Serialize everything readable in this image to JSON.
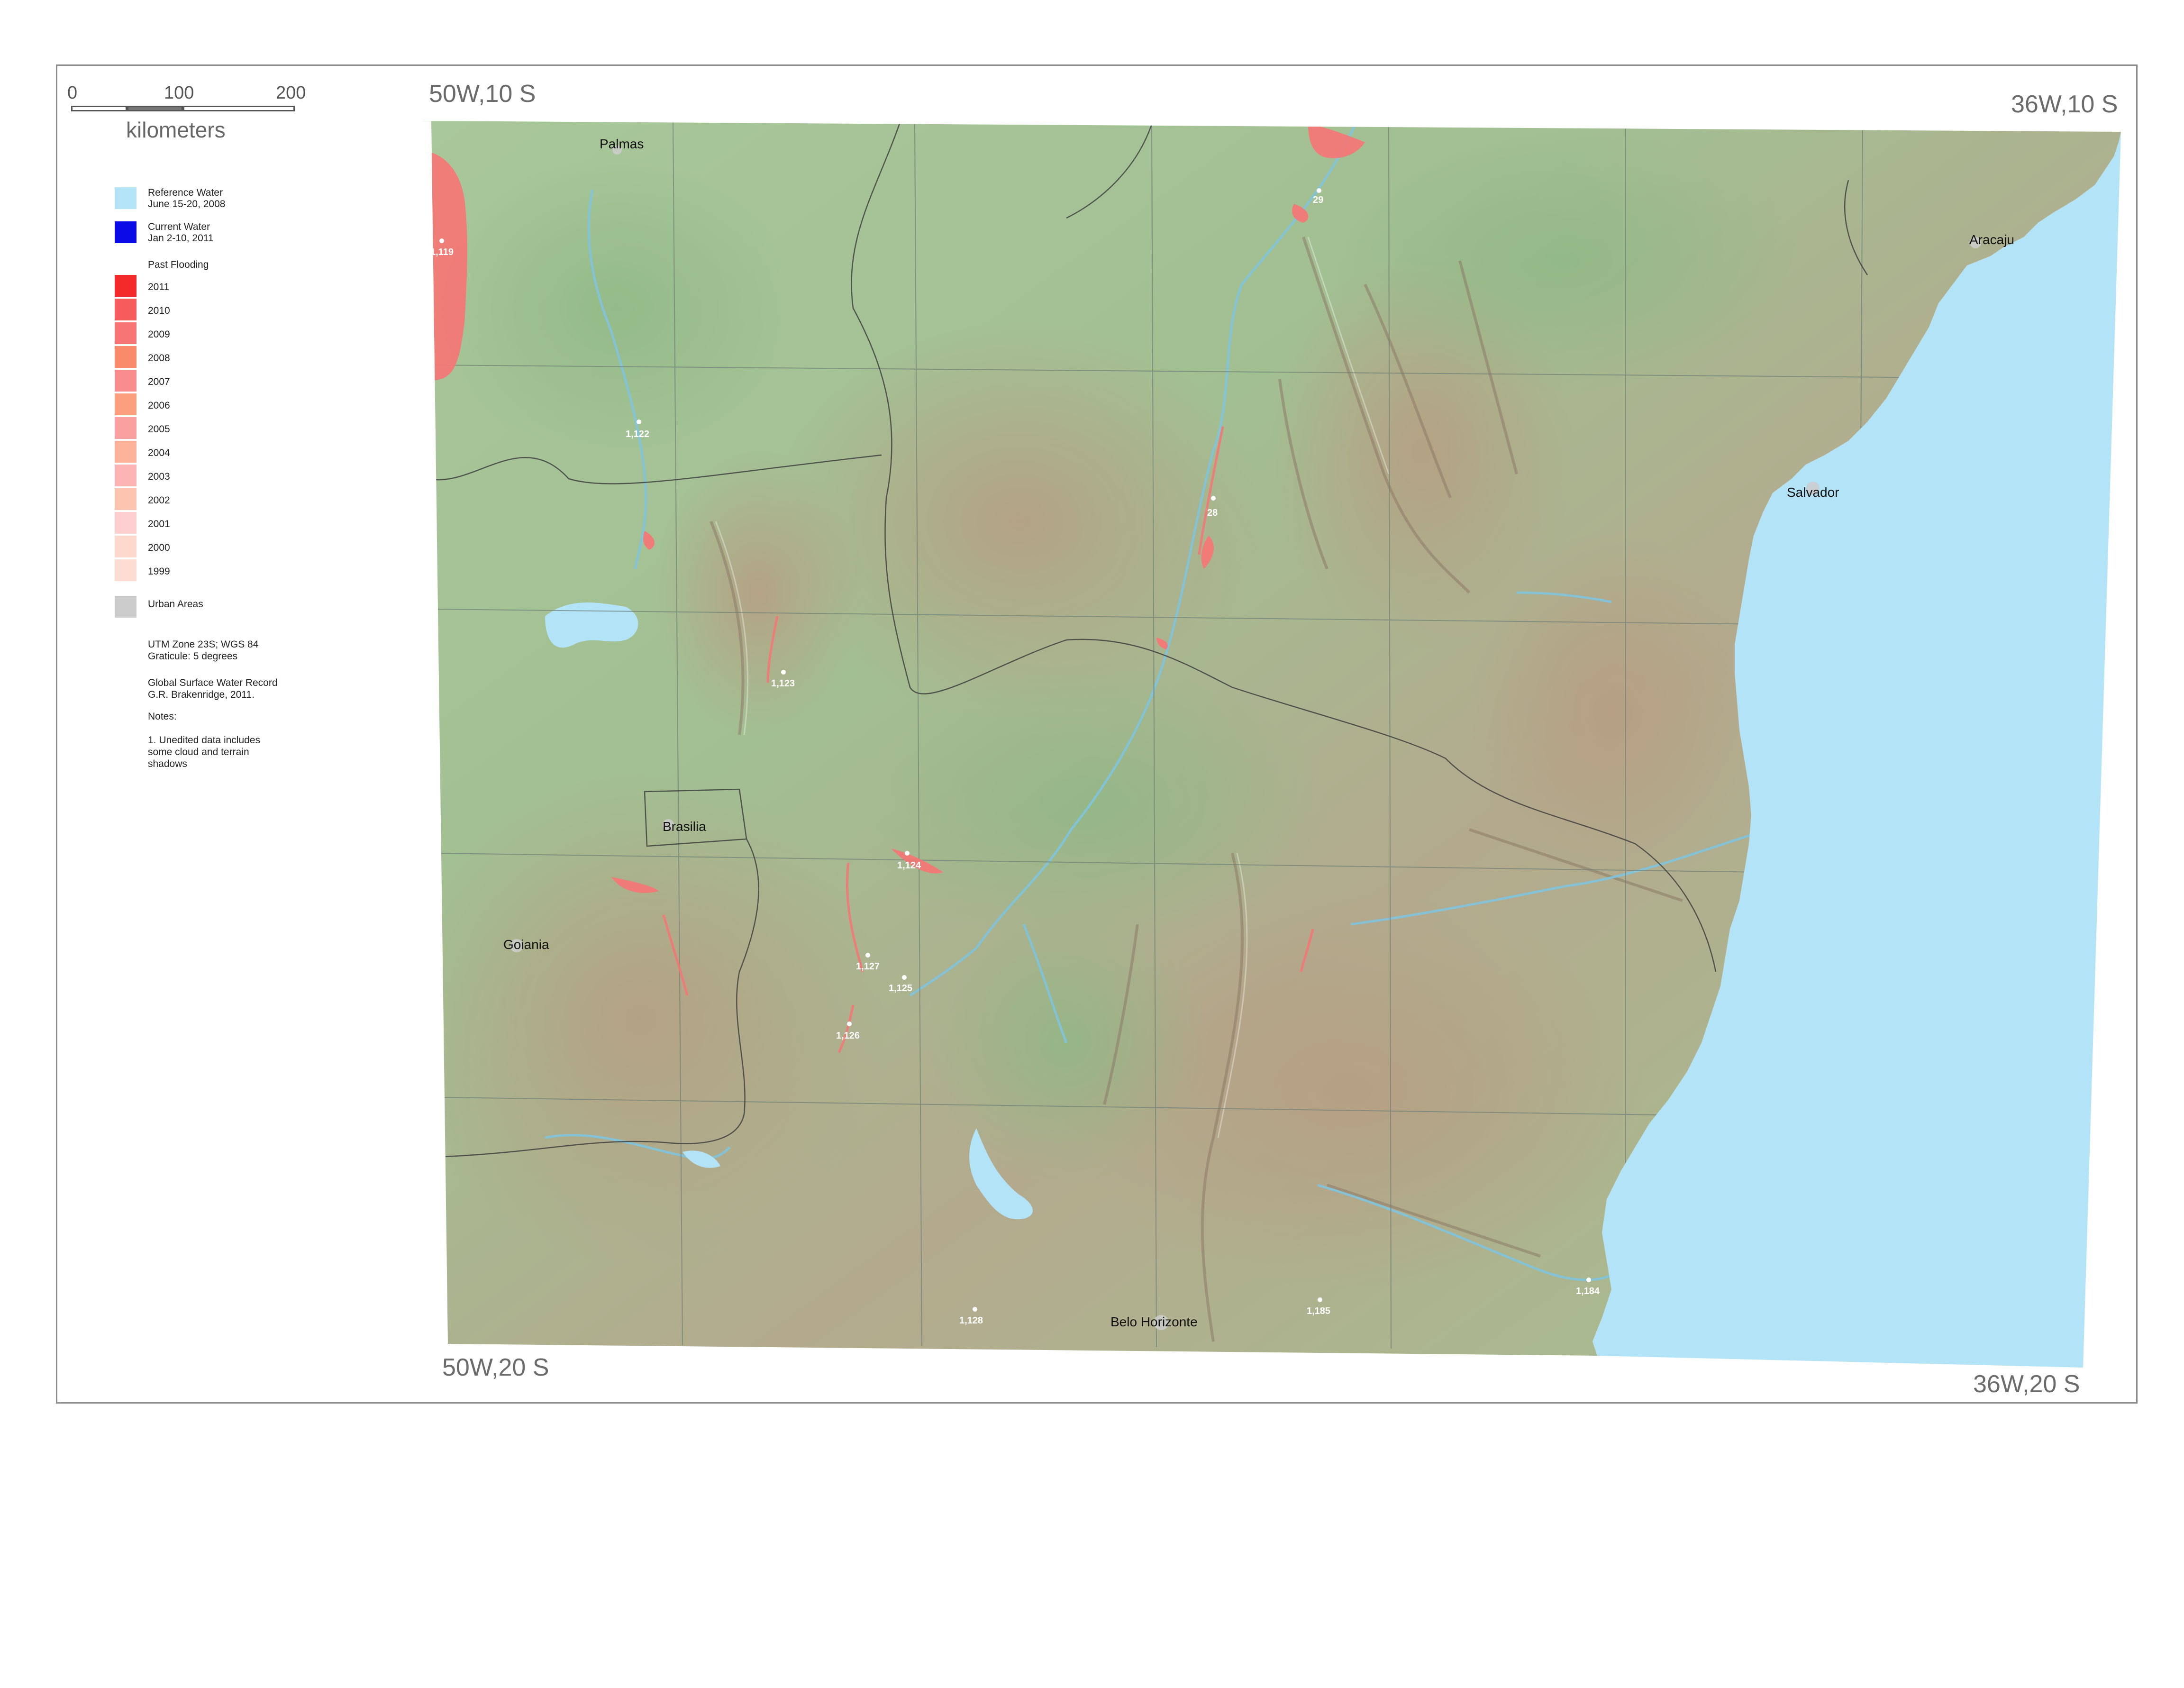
{
  "corners": {
    "top_left": "50W,10 S",
    "top_right": "36W,10 S",
    "bottom_left": "50W,20 S",
    "bottom_right": "36W,20 S"
  },
  "scale": {
    "ticks": [
      "0",
      "100",
      "200"
    ],
    "units": "kilometers"
  },
  "legend": {
    "reference_water": {
      "line1": "Reference Water",
      "line2": "June 15-20, 2008",
      "color": "#b3e3f7"
    },
    "current_water": {
      "line1": "Current  Water",
      "line2": "Jan 2-10, 2011",
      "color": "#0a0ae6"
    },
    "past_flooding_title": "Past Flooding",
    "years": [
      {
        "label": "2011",
        "color": "#f42a2a"
      },
      {
        "label": "2010",
        "color": "#f65c5c"
      },
      {
        "label": "2009",
        "color": "#f77474"
      },
      {
        "label": "2008",
        "color": "#f98a6a"
      },
      {
        "label": "2007",
        "color": "#f98c8c"
      },
      {
        "label": "2006",
        "color": "#fb9f7e"
      },
      {
        "label": "2005",
        "color": "#fba0a0"
      },
      {
        "label": "2004",
        "color": "#fcb39a"
      },
      {
        "label": "2003",
        "color": "#fcb4b4"
      },
      {
        "label": "2002",
        "color": "#fdc4b0"
      },
      {
        "label": "2001",
        "color": "#fdcfcf"
      },
      {
        "label": "2000",
        "color": "#fdd8cc"
      },
      {
        "label": "1999",
        "color": "#fcdcd3"
      }
    ],
    "urban": {
      "label": "Urban Areas",
      "color": "#cccccc"
    },
    "projection": "UTM Zone 23S; WGS 84\nGraticule:  5 degrees",
    "source": "Global Surface Water Record\nG.R. Brakenridge, 2011.",
    "notes_title": "Notes:",
    "note1": "1. Unedited data includes\nsome cloud and terrain\nshadows"
  },
  "cities": {
    "palmas": "Palmas",
    "aracaju": "Aracaju",
    "salvador": "Salvador",
    "brasilia": "Brasilia",
    "goiania": "Goiania",
    "belo_horizonte": "Belo Horizonte"
  },
  "gauges": {
    "g1119": "1,119",
    "g1122": "1,122",
    "g29": "29",
    "g28": "28",
    "g1123": "1,123",
    "g1124": "1,124",
    "g1127": "1,127",
    "g1125": "1,125",
    "g1126": "1,126",
    "g1128": "1,128",
    "g1185": "1,185",
    "g1184": "1,184"
  },
  "colors": {
    "terrain_green": "#9fbd8e",
    "terrain_brown": "#b9a98c",
    "ocean": "#b3e3f7",
    "graticule": "#6f7f78",
    "flood": "#f77474"
  }
}
